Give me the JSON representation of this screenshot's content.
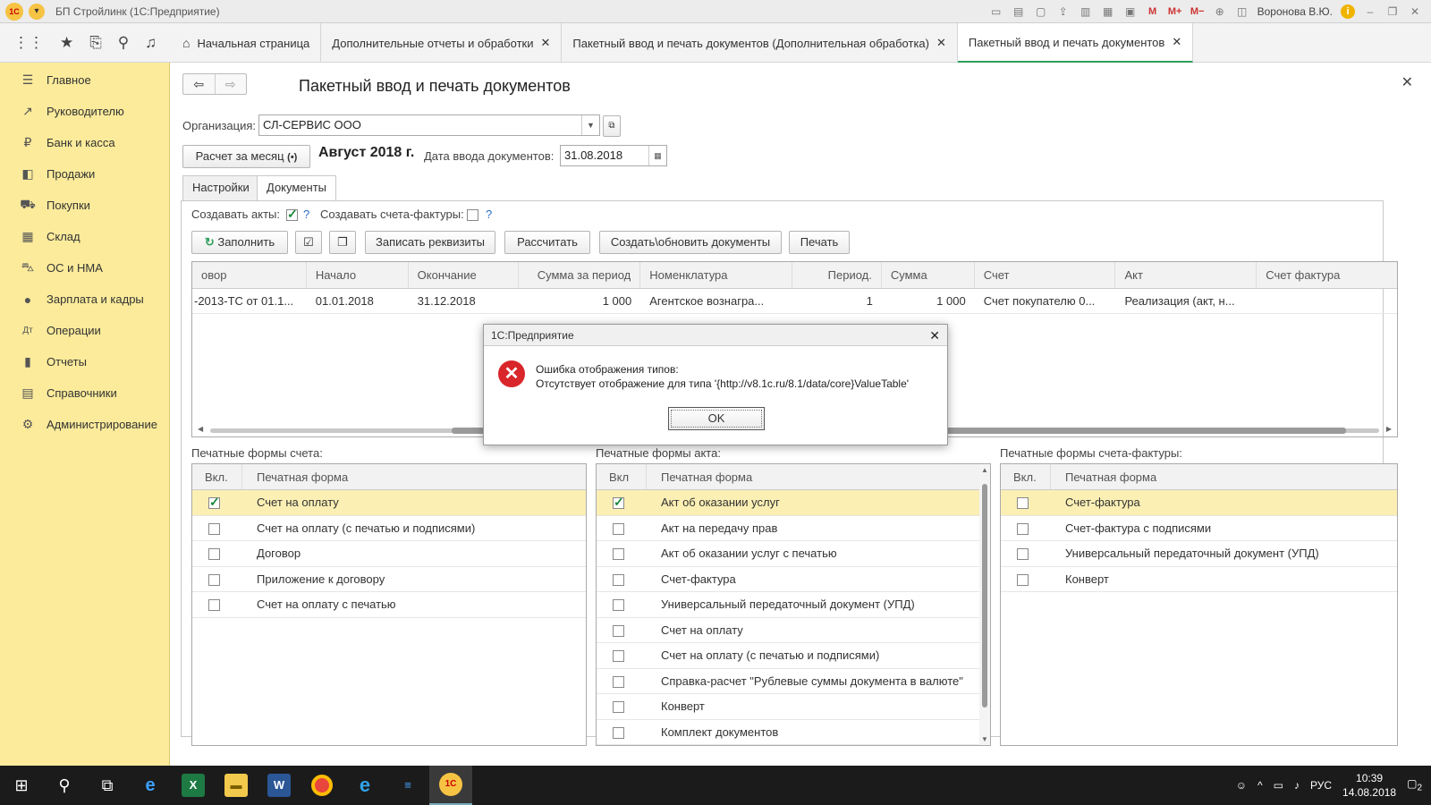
{
  "window": {
    "title": "БП Стройлинк (1С:Предприятие)",
    "user": "Воронова В.Ю."
  },
  "tabs": [
    {
      "label": "Начальная страница"
    },
    {
      "label": "Дополнительные отчеты и обработки"
    },
    {
      "label": "Пакетный ввод и печать документов (Дополнительная обработка)"
    },
    {
      "label": "Пакетный ввод и печать документов"
    }
  ],
  "sidebar": {
    "items": [
      {
        "label": "Главное",
        "icon": "menu-icon"
      },
      {
        "label": "Руководителю",
        "icon": "chart-trend-icon"
      },
      {
        "label": "Банк и касса",
        "icon": "ruble-coin-icon"
      },
      {
        "label": "Продажи",
        "icon": "sales-icon"
      },
      {
        "label": "Покупки",
        "icon": "cart-icon"
      },
      {
        "label": "Склад",
        "icon": "warehouse-icon"
      },
      {
        "label": "ОС и НМА",
        "icon": "truck-icon"
      },
      {
        "label": "Зарплата и кадры",
        "icon": "person-icon"
      },
      {
        "label": "Операции",
        "icon": "operations-icon"
      },
      {
        "label": "Отчеты",
        "icon": "bar-chart-icon"
      },
      {
        "label": "Справочники",
        "icon": "books-icon"
      },
      {
        "label": "Администрирование",
        "icon": "gear-icon"
      }
    ]
  },
  "form": {
    "title": "Пакетный ввод и печать документов",
    "org_label": "Организация:",
    "org_value": "СЛ-СЕРВИС ООО",
    "calc_button": "Расчет за месяц",
    "period": "Август 2018 г.",
    "date_label": "Дата ввода документов:",
    "date_value": "31.08.2018",
    "tab_settings": "Настройки",
    "tab_documents": "Документы",
    "create_acts_label": "Создавать акты:",
    "create_acts_checked": true,
    "create_invoices_label": "Создавать счета-фактуры:",
    "create_invoices_checked": false,
    "help": "?"
  },
  "toolbar": {
    "fill": "Заполнить",
    "save_details": "Записать реквизиты",
    "calculate": "Рассчитать",
    "create_update": "Создать\\обновить документы",
    "print": "Печать"
  },
  "grid": {
    "columns": [
      "овор",
      "Начало",
      "Окончание",
      "Сумма за период",
      "Номенклатура",
      "Период.",
      "Сумма",
      "Счет",
      "Акт",
      "Счет фактура"
    ],
    "rows": [
      [
        "-2013-ТС от 01.1...",
        "01.01.2018",
        "31.12.2018",
        "1 000",
        "Агентское вознагра...",
        "1",
        "1 000",
        "Счет покупателю 0...",
        "Реализация (акт, н...",
        ""
      ]
    ]
  },
  "print_forms": {
    "col_enabled": "Вкл.",
    "col_enabled_alt": "Вкл",
    "col_form": "Печатная форма",
    "invoice": {
      "title": "Печатные формы счета:",
      "items": [
        {
          "label": "Счет на оплату",
          "checked": true
        },
        {
          "label": "Счет на оплату (с печатью и подписями)",
          "checked": false
        },
        {
          "label": "Договор",
          "checked": false
        },
        {
          "label": "Приложение к договору",
          "checked": false
        },
        {
          "label": "Счет на оплату с печатью",
          "checked": false
        }
      ]
    },
    "act": {
      "title": "Печатные формы акта:",
      "items": [
        {
          "label": "Акт об оказании услуг",
          "checked": true
        },
        {
          "label": "Акт на передачу прав",
          "checked": false
        },
        {
          "label": "Акт об оказании услуг с печатью",
          "checked": false
        },
        {
          "label": "Счет-фактура",
          "checked": false
        },
        {
          "label": "Универсальный передаточный документ (УПД)",
          "checked": false
        },
        {
          "label": "Счет на оплату",
          "checked": false
        },
        {
          "label": "Счет на оплату (с печатью и подписями)",
          "checked": false
        },
        {
          "label": "Справка-расчет \"Рублевые суммы документа в валюте\"",
          "checked": false
        },
        {
          "label": "Конверт",
          "checked": false
        },
        {
          "label": "Комплект документов",
          "checked": false
        }
      ]
    },
    "vat_invoice": {
      "title": "Печатные формы счета-фактуры:",
      "items": [
        {
          "label": "Счет-фактура",
          "checked": false
        },
        {
          "label": "Счет-фактура с подписями",
          "checked": false
        },
        {
          "label": "Универсальный передаточный документ (УПД)",
          "checked": false
        },
        {
          "label": "Конверт",
          "checked": false
        }
      ]
    }
  },
  "dialog": {
    "title": "1С:Предприятие",
    "line1": "Ошибка отображения типов:",
    "line2": "Отсутствует отображение для типа '{http://v8.1c.ru/8.1/data/core}ValueTable'",
    "ok": "OK"
  },
  "taskbar": {
    "lang": "РУС",
    "time": "10:39",
    "date": "14.08.2018",
    "notifications": "2"
  },
  "colors": {
    "sidebar": "#fbeb9b",
    "selected_row": "#fbefb4",
    "active_tab_accent": "#2e9e5b",
    "error": "#d9262b"
  }
}
